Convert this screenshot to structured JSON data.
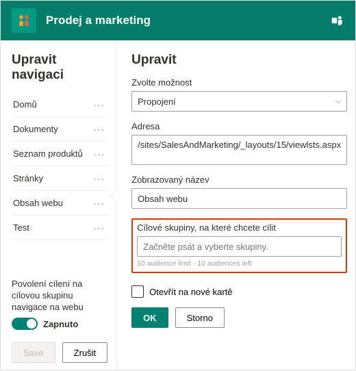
{
  "header": {
    "site_title": "Prodej a marketing"
  },
  "left": {
    "title": "Upravit navigaci",
    "items": [
      {
        "label": "Domů"
      },
      {
        "label": "Dokumenty"
      },
      {
        "label": "Seznam produktů"
      },
      {
        "label": "Stránky"
      },
      {
        "label": "Obsah webu"
      },
      {
        "label": "Test"
      }
    ],
    "targeting_label": "Povolení cílení na cílovou skupinu navigace na webu",
    "toggle_state": "Zapnuto",
    "save_label": "Save",
    "cancel_label": "Zrušit"
  },
  "right": {
    "title": "Upravit",
    "option_label": "Zvolte možnost",
    "option_value": "Propojení",
    "address_label": "Adresa",
    "address_value": "/sites/SalesAndMarketing/_layouts/15/viewlsts.aspx",
    "display_label": "Zobrazovaný název",
    "display_value": "Obsah webu",
    "audience_label": "Cílové skupiny, na které chcete cílit",
    "audience_placeholder": "Začněte psát a vyberte skupiny.",
    "audience_hint": "10 audience limit - 10 audiences left",
    "newtab_label": "Otevřít na nové kartě",
    "ok_label": "OK",
    "storno_label": "Storno"
  }
}
